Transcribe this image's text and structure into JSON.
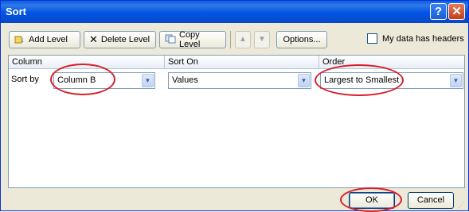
{
  "window": {
    "title": "Sort"
  },
  "toolbar": {
    "add_level": "Add Level",
    "delete_level": "Delete Level",
    "copy_level": "Copy Level",
    "options": "Options...",
    "headers_checkbox_label": "My data has headers",
    "headers_checked": false
  },
  "grid": {
    "headers": [
      "Column",
      "Sort On",
      "Order"
    ],
    "rows": [
      {
        "label": "Sort by",
        "column": "Column B",
        "sort_on": "Values",
        "order": "Largest to Smallest"
      }
    ]
  },
  "buttons": {
    "ok": "OK",
    "cancel": "Cancel"
  },
  "annotations": {
    "highlight_color": "#d8202b"
  }
}
